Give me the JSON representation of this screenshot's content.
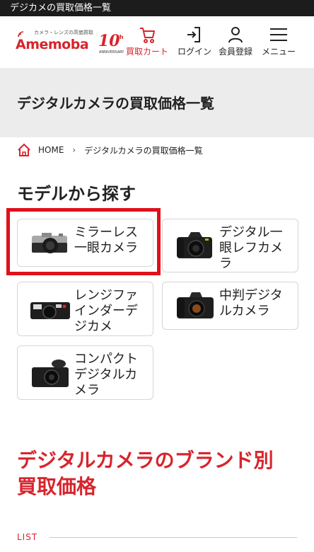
{
  "topbar": {
    "title": "デジカメの買取価格一覧"
  },
  "header": {
    "logo": {
      "tagline": "カメラ・レンズの高価買取",
      "name": "Amemoba",
      "anniversary_number": "10",
      "anniversary_suffix": "th",
      "anniversary_text": "ANNIVERSARY"
    },
    "nav": [
      {
        "label": "買取カート",
        "icon": "cart-icon"
      },
      {
        "label": "ログイン",
        "icon": "login-icon"
      },
      {
        "label": "会員登録",
        "icon": "user-icon"
      },
      {
        "label": "メニュー",
        "icon": "hamburger-menu-icon"
      }
    ]
  },
  "page": {
    "title": "デジタルカメラの買取価格一覧"
  },
  "breadcrumb": {
    "home": "HOME",
    "current": "デジタルカメラの買取価格一覧"
  },
  "models": {
    "heading": "モデルから探す",
    "items": [
      {
        "label": "ミラーレス一眼カメラ",
        "icon": "mirrorless-camera-icon"
      },
      {
        "label": "デジタル一眼レフカメラ",
        "icon": "dslr-camera-icon"
      },
      {
        "label": "レンジファインダーデジカメ",
        "icon": "rangefinder-camera-icon"
      },
      {
        "label": "中判デジタルカメラ",
        "icon": "medium-format-camera-icon"
      },
      {
        "label": "コンパクトデジタルカメラ",
        "icon": "compact-camera-icon"
      }
    ]
  },
  "brands": {
    "heading_line1": "デジタルカメラのブランド別",
    "heading_line2": "買取価格",
    "sub": "LIST"
  },
  "colors": {
    "brand_red": "#d8242c",
    "highlight_red": "#e0101b",
    "topbar": "#1c1c1c",
    "band": "#ececec"
  }
}
